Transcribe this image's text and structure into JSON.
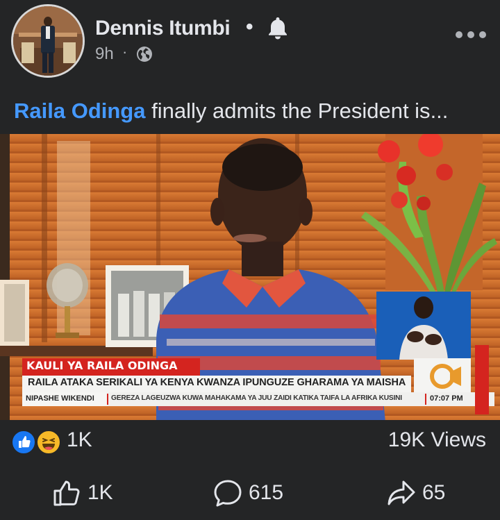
{
  "post": {
    "author": "Dennis Itumbi",
    "follow_separator": "•",
    "time": "9h",
    "meta_separator": "·",
    "caption_mention": "Raila Odinga",
    "caption_text": " finally admits the President is",
    "caption_ellipsis": "..."
  },
  "video": {
    "lower_third_title": "KAULI YA RAILA ODINGA",
    "lower_third_subtitle": "RAILA ATAKA SERIKALI YA KENYA KWANZA IPUNGUZE GHARAMA YA MAISHA",
    "program": "NIPASHE WIKENDI",
    "ticker": "GEREZA LAGEUZWA KUWA MAHAKAMA YA JUU ZAIDI KATIKA TAIFA LA AFRIKA KUSINI",
    "clock": "07:07 PM",
    "channel_logo_icon": "citizen-tv-logo-icon"
  },
  "engagement": {
    "reaction_count": "1K",
    "views": "19K Views",
    "like_count": "1K",
    "comment_count": "615",
    "share_count": "65"
  },
  "colors": {
    "background": "#242526",
    "mention": "#4599ff",
    "like_blue": "#1877f2",
    "haha_yellow": "#f7b928",
    "lower_third_red": "#d4241f"
  }
}
